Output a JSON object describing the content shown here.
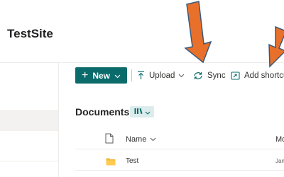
{
  "site": {
    "title": "TestSite"
  },
  "toolbar": {
    "new_label": "New",
    "upload_label": "Upload",
    "sync_label": "Sync",
    "add_shortcut_label": "Add shortcut"
  },
  "library": {
    "title": "Documents"
  },
  "columns": {
    "name": "Name",
    "modified": "Mo"
  },
  "rows": [
    {
      "name": "Test",
      "modified": "Jan"
    }
  ],
  "colors": {
    "accent": "#0b6a6a",
    "arrow": "#e8702a",
    "folder": "#f2b73b"
  },
  "icons": [
    "plus-icon",
    "upload-icon",
    "sync-icon",
    "shortcut-icon",
    "library-view-icon",
    "file-type-icon",
    "folder-icon",
    "chevron-down-icon"
  ]
}
